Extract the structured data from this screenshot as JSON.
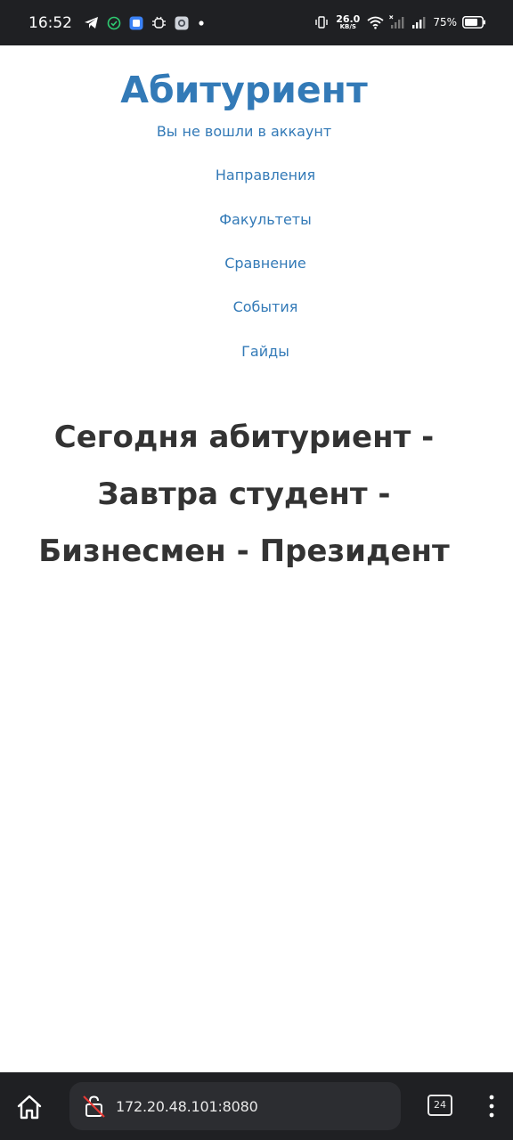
{
  "status_bar": {
    "time": "16:52",
    "net_speed_value": "26.0",
    "net_speed_unit": "KB/S",
    "battery_percent": "75%",
    "icons": [
      "telegram-icon",
      "sync-check-icon",
      "app-notification-icon",
      "android-debug-icon",
      "settings-app-icon",
      "dot-icon",
      "vibrate-icon",
      "wifi-icon",
      "mobile-signal-off-icon",
      "mobile-signal-icon",
      "battery-icon"
    ]
  },
  "site": {
    "title": "Абитуриент",
    "auth_status": "Вы не вошли в аккаунт"
  },
  "nav": {
    "items": [
      {
        "label": "Направления"
      },
      {
        "label": "Факультеты"
      },
      {
        "label": "Сравнение"
      },
      {
        "label": "События"
      },
      {
        "label": "Гайды"
      }
    ]
  },
  "slogan": {
    "lines": [
      "Сегодня абитуриент -",
      "Завтра студент -",
      "Бизнесмен - Президент"
    ]
  },
  "browser": {
    "url": "172.20.48.101:8080",
    "tab_count": "24",
    "icons": [
      "home-icon",
      "not-secure-lock-icon",
      "tabs-icon",
      "more-menu-icon"
    ]
  },
  "colors": {
    "link": "#337ab7",
    "heading": "#333333",
    "system_bar": "#1f2023"
  }
}
